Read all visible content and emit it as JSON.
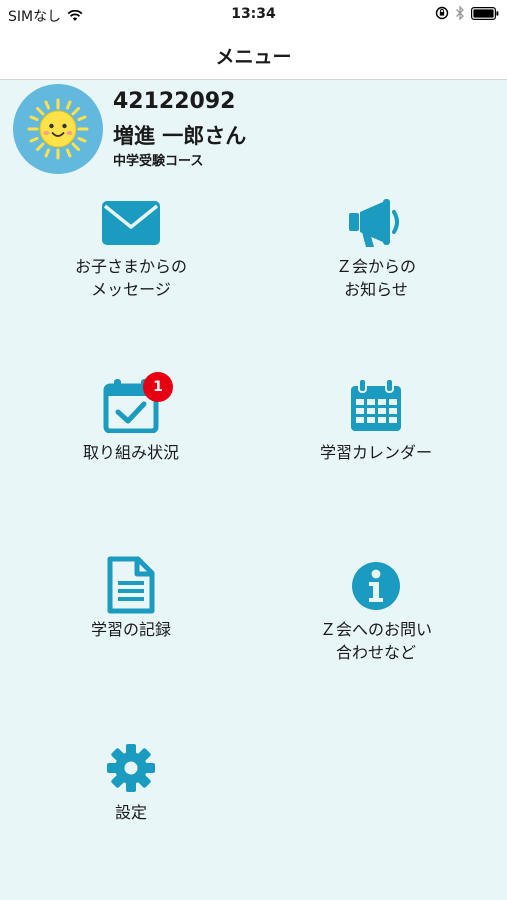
{
  "status_bar": {
    "carrier": "SIMなし",
    "time": "13:34"
  },
  "nav": {
    "title": "メニュー"
  },
  "profile": {
    "id": "42122092",
    "name": "増進 一郎さん",
    "course": "中学受験コース"
  },
  "menu": {
    "messages": {
      "line1": "お子さまからの",
      "line2": "メッセージ"
    },
    "news": {
      "line1": "Ｚ会からの",
      "line2": "お知らせ"
    },
    "progress": {
      "label": "取り組み状況",
      "badge": "1"
    },
    "calendar": {
      "label": "学習カレンダー"
    },
    "records": {
      "label": "学習の記録"
    },
    "contact": {
      "line1": "Ｚ会へのお問い",
      "line2": "合わせなど"
    },
    "settings": {
      "label": "設定"
    }
  },
  "colors": {
    "accent": "#1a9bbf",
    "background": "#e8f6f8",
    "badge": "#e60012",
    "avatar_bg": "#63b8dd",
    "sun": "#ffe24a"
  },
  "icons": [
    "wifi-icon",
    "orientation-lock-icon",
    "bluetooth-icon",
    "battery-icon",
    "envelope-icon",
    "megaphone-icon",
    "calendar-check-icon",
    "calendar-grid-icon",
    "document-icon",
    "info-icon",
    "gear-icon"
  ]
}
